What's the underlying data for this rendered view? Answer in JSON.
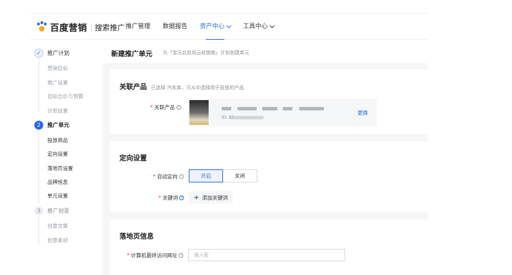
{
  "header": {
    "logo_brand": "百度营销",
    "logo_sub": "搜索推广",
    "nav": [
      {
        "label": "推广管理",
        "active": false,
        "dropdown": false
      },
      {
        "label": "数据报告",
        "active": false,
        "dropdown": false
      },
      {
        "label": "资产中心",
        "active": true,
        "dropdown": true
      },
      {
        "label": "工具中心",
        "active": false,
        "dropdown": true
      }
    ]
  },
  "steps": [
    {
      "num": "✓",
      "label": "推广计划",
      "state": "done",
      "subs": [
        "营销目标",
        "推广设置",
        "目标出价与预算",
        "计划设置"
      ]
    },
    {
      "num": "2",
      "label": "推广单元",
      "state": "active",
      "subs": [
        "投放商品",
        "定向设置",
        "落地页设置",
        "品牌信息",
        "单元设置"
      ]
    },
    {
      "num": "3",
      "label": "推广创意",
      "state": "todo",
      "subs": [
        "创意文案",
        "创意素材"
      ]
    }
  ],
  "page": {
    "title": "新建推广单元",
    "subtitle": "为『宝马北京风云经销商』计划创建单元"
  },
  "product_card": {
    "title": "关联产品",
    "note": "已选择 汽车库，可从中选择用于投放的产品",
    "field_label": "关联产品",
    "id_label": "ID: 83",
    "change_link": "更换"
  },
  "targeting_card": {
    "title": "定向设置",
    "auto_label": "自动定向",
    "on_label": "开启",
    "off_label": "关闭",
    "keyword_label": "关键词",
    "add_keyword": "添加关键词"
  },
  "landing_card": {
    "title": "落地页信息",
    "url_label": "计算机最终访问网址",
    "url_placeholder": "输入框"
  },
  "colors": {
    "accent": "#2468f2",
    "required": "#e53935",
    "canvas": "#f5f6f8"
  }
}
